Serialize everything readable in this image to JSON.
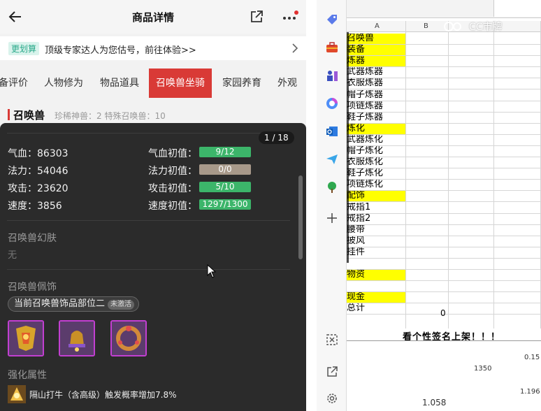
{
  "header": {
    "title": "商品详情",
    "back_icon": "arrow-left-icon",
    "share_icon": "share-icon",
    "more_icon": "more-dots-icon"
  },
  "banner": {
    "tag": "更划算",
    "text": "顶级专家达人为您估号，前往体验>>"
  },
  "tabs": [
    {
      "label": "备评价"
    },
    {
      "label": "人物修为"
    },
    {
      "label": "物品道具"
    },
    {
      "label": "召唤兽坐骑",
      "active": true
    },
    {
      "label": "家园养育"
    },
    {
      "label": "外观"
    }
  ],
  "summon": {
    "title": "召唤兽",
    "stats": "珍稀神兽：2   特殊召唤兽：10"
  },
  "popup": {
    "page_counter": "1 / 18",
    "stats_left": [
      {
        "label": "气血：86303"
      },
      {
        "label": "法力：54046"
      },
      {
        "label": "攻击：23620"
      },
      {
        "label": "速度：3856"
      }
    ],
    "stats_right": [
      {
        "label": "气血初值：",
        "value": "9/12",
        "fraction": 0.75,
        "color": "#3cb56a"
      },
      {
        "label": "法力初值：",
        "value": "0/0",
        "fraction": 0,
        "color": "#a8998a"
      },
      {
        "label": "攻击初值：",
        "value": "5/10",
        "fraction": 0.5,
        "color": "#3cb56a"
      },
      {
        "label": "速度初值：",
        "value": "1297/1300",
        "fraction": 0.998,
        "color": "#3cb56a"
      }
    ],
    "skin_title": "召唤兽幻肤",
    "skin_value": "无",
    "deco_title": "召唤兽佩饰",
    "deco_pill": "当前召唤兽饰品部位二",
    "deco_badge": "未激活",
    "enhance_title": "强化属性",
    "enhance_text": "隔山打牛（含高级）触发概率增加7.8%"
  },
  "sidebar": {
    "icons": [
      "tag-icon",
      "toolbox-icon",
      "chess-icon",
      "copilot-icon",
      "outlook-icon",
      "send-icon",
      "tree-icon",
      "plus-icon",
      "screenshot-icon",
      "external-link-icon",
      "settings-gear-icon"
    ]
  },
  "sheet": {
    "col_a": "A",
    "col_b": "B",
    "rows": [
      {
        "text": "召唤兽",
        "yellow": true
      },
      {
        "text": "装备",
        "yellow": true
      },
      {
        "text": "炼器",
        "yellow": true
      },
      {
        "text": "武器炼器",
        "yellow": false
      },
      {
        "text": "衣服炼器",
        "yellow": false
      },
      {
        "text": "帽子炼器",
        "yellow": false
      },
      {
        "text": "项链炼器",
        "yellow": false
      },
      {
        "text": "鞋子炼器",
        "yellow": false
      },
      {
        "text": "炼化",
        "yellow": true
      },
      {
        "text": "武器炼化",
        "yellow": false
      },
      {
        "text": "帽子炼化",
        "yellow": false
      },
      {
        "text": "衣服炼化",
        "yellow": false
      },
      {
        "text": "鞋子炼化",
        "yellow": false
      },
      {
        "text": "项链炼化",
        "yellow": false
      },
      {
        "text": "配饰",
        "yellow": true
      },
      {
        "text": "戒指1",
        "yellow": false
      },
      {
        "text": "戒指2",
        "yellow": false
      },
      {
        "text": "腰带",
        "yellow": false
      },
      {
        "text": "披风",
        "yellow": false
      },
      {
        "text": "挂件",
        "yellow": false
      },
      {
        "text": "",
        "yellow": false
      },
      {
        "text": "物资",
        "yellow": true
      },
      {
        "text": "",
        "yellow": false
      },
      {
        "text": "现金",
        "yellow": true
      },
      {
        "text": "总计",
        "yellow": false
      }
    ],
    "total_value": "0",
    "sign_text": "看个性签名上架！！！",
    "num1": "0.15",
    "num2": "1350",
    "num3": "1.196",
    "num4": "1.058",
    "watermark": "CC市牌"
  }
}
